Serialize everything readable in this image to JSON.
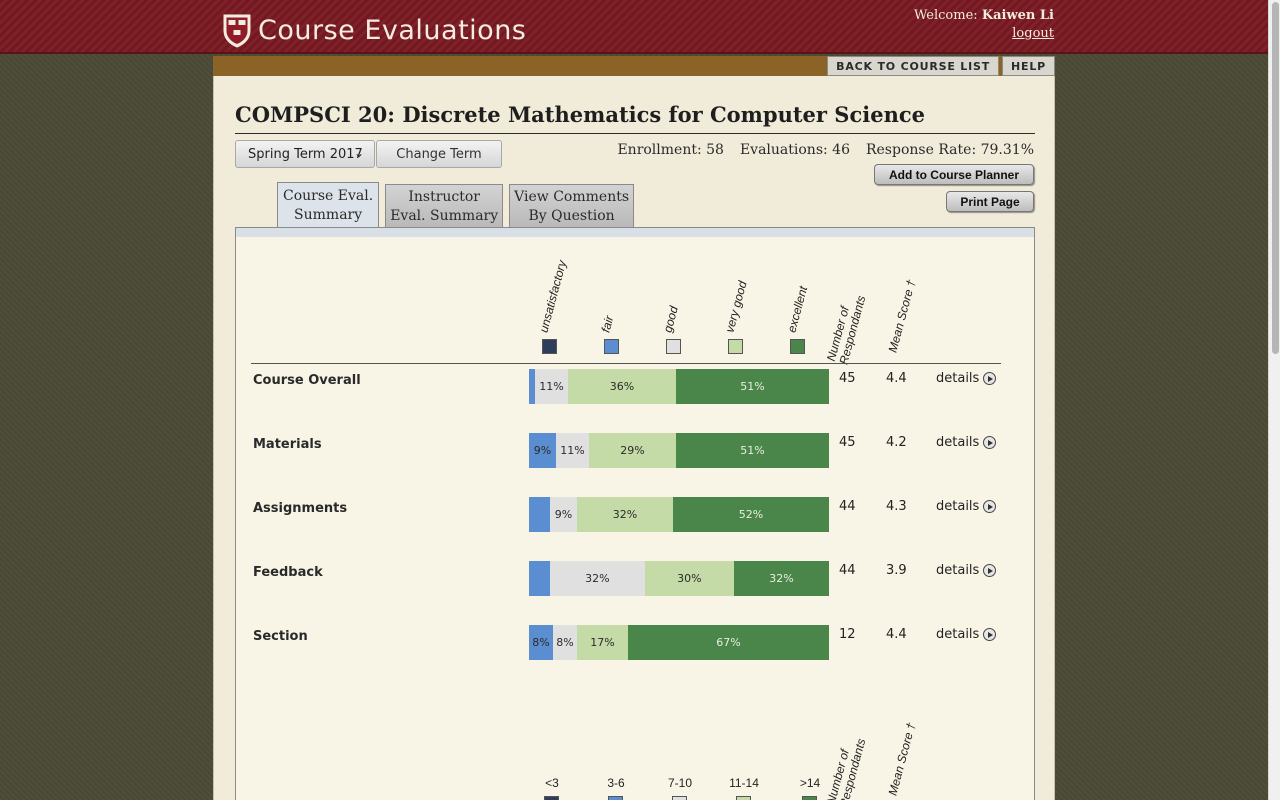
{
  "header": {
    "app_title": "Course Evaluations",
    "welcome_prefix": "Welcome:",
    "user_name": "Kaiwen Li",
    "logout_label": "logout"
  },
  "nav": {
    "back_label": "BACK TO COURSE LIST",
    "help_label": "HELP"
  },
  "course": {
    "title": "COMPSCI 20: Discrete Mathematics for Computer Science",
    "term": "Spring Term 2017",
    "change_term_label": "Change Term",
    "enrollment": "Enrollment: 58",
    "evaluations": "Evaluations: 46",
    "response_rate": "Response Rate: 79.31%",
    "add_planner_label": "Add to Course Planner",
    "print_label": "Print Page"
  },
  "tabs": [
    {
      "line1": "Course Eval.",
      "line2": "Summary",
      "active": true
    },
    {
      "line1": "Instructor",
      "line2": "Eval. Summary",
      "active": false
    },
    {
      "line1": "View Comments",
      "line2": "By Question",
      "active": false
    }
  ],
  "legend": {
    "ratings": [
      {
        "label": "unsatisfactory",
        "color": "#2e3d5c"
      },
      {
        "label": "fair",
        "color": "#5b8ed0"
      },
      {
        "label": "good",
        "color": "#e0e0e0"
      },
      {
        "label": "very good",
        "color": "#c5dba7"
      },
      {
        "label": "excellent",
        "color": "#4a8549"
      }
    ],
    "respondents_line1": "Number of",
    "respondents_line2": "Respondants",
    "mean_label": "Mean Score †"
  },
  "chart_data": {
    "type": "bar",
    "stacked": true,
    "orientation": "horizontal",
    "categories": [
      "Course Overall",
      "Materials",
      "Assignments",
      "Feedback",
      "Section"
    ],
    "series": [
      {
        "name": "unsatisfactory",
        "values": [
          0,
          0,
          0,
          0,
          0
        ]
      },
      {
        "name": "fair",
        "values": [
          2,
          9,
          7,
          7,
          8
        ]
      },
      {
        "name": "good",
        "values": [
          11,
          11,
          9,
          32,
          8
        ]
      },
      {
        "name": "very good",
        "values": [
          36,
          29,
          32,
          30,
          17
        ]
      },
      {
        "name": "excellent",
        "values": [
          51,
          51,
          52,
          32,
          67
        ]
      }
    ],
    "value_labels": [
      [
        "",
        "",
        "11%",
        "36%",
        "51%"
      ],
      [
        "",
        "9%",
        "11%",
        "29%",
        "51%"
      ],
      [
        "",
        "",
        "9%",
        "32%",
        "52%"
      ],
      [
        "",
        "",
        "32%",
        "30%",
        "32%"
      ],
      [
        "",
        "8%",
        "8%",
        "17%",
        "67%"
      ]
    ],
    "respondents": [
      "45",
      "45",
      "44",
      "44",
      "12"
    ],
    "mean_scores": [
      "4.4",
      "4.2",
      "4.3",
      "3.9",
      "4.4"
    ]
  },
  "details_label": "details",
  "hours": {
    "labels": [
      "<3",
      "3-6",
      "7-10",
      "11-14",
      ">14"
    ],
    "colors": [
      "#2e3d5c",
      "#5b8ed0",
      "#e0e0e0",
      "#c5dba7",
      "#4a8549"
    ],
    "respondents_line1": "Number of",
    "respondents_line2": "Respondants",
    "mean_label": "Mean Score †"
  }
}
